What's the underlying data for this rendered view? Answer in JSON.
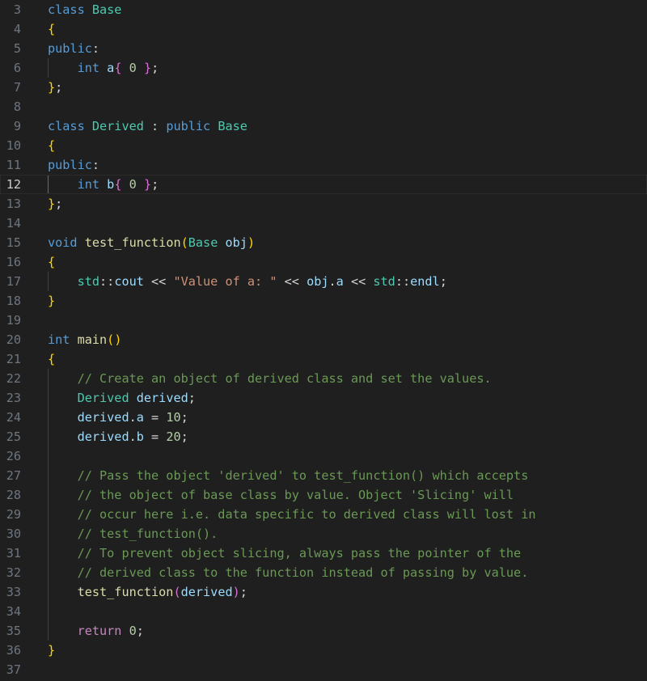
{
  "editor": {
    "theme_colors": {
      "background": "#1f1f1f",
      "keyword": "#569cd6",
      "control_keyword": "#c586c0",
      "type": "#4ec9b0",
      "variable": "#9cdcfe",
      "function": "#dcdcaa",
      "number": "#b5cea8",
      "string": "#ce9178",
      "comment": "#6a9955",
      "bracket_level_1": "#ffd700",
      "bracket_level_2": "#da70d6",
      "bracket_level_3": "#179fff",
      "line_number": "#6e7681"
    },
    "active_line_number": 12,
    "lines": [
      {
        "n": 3,
        "tokens": [
          [
            "kw",
            "class"
          ],
          [
            "op",
            " "
          ],
          [
            "type",
            "Base"
          ]
        ]
      },
      {
        "n": 4,
        "tokens": [
          [
            "br1",
            "{"
          ]
        ]
      },
      {
        "n": 5,
        "tokens": [
          [
            "kw",
            "public"
          ],
          [
            "op",
            ":"
          ]
        ]
      },
      {
        "n": 6,
        "tokens": [
          [
            "op",
            "    "
          ],
          [
            "kw",
            "int"
          ],
          [
            "op",
            " "
          ],
          [
            "var",
            "a"
          ],
          [
            "br2",
            "{"
          ],
          [
            "op",
            " "
          ],
          [
            "num",
            "0"
          ],
          [
            "op",
            " "
          ],
          [
            "br2",
            "}"
          ],
          [
            "op",
            ";"
          ]
        ]
      },
      {
        "n": 7,
        "tokens": [
          [
            "br1",
            "}"
          ],
          [
            "op",
            ";"
          ]
        ]
      },
      {
        "n": 8,
        "tokens": []
      },
      {
        "n": 9,
        "tokens": [
          [
            "kw",
            "class"
          ],
          [
            "op",
            " "
          ],
          [
            "type",
            "Derived"
          ],
          [
            "op",
            " : "
          ],
          [
            "kw",
            "public"
          ],
          [
            "op",
            " "
          ],
          [
            "type",
            "Base"
          ]
        ]
      },
      {
        "n": 10,
        "tokens": [
          [
            "br1",
            "{"
          ]
        ]
      },
      {
        "n": 11,
        "tokens": [
          [
            "kw",
            "public"
          ],
          [
            "op",
            ":"
          ]
        ]
      },
      {
        "n": 12,
        "tokens": [
          [
            "op",
            "    "
          ],
          [
            "kw",
            "int"
          ],
          [
            "op",
            " "
          ],
          [
            "var",
            "b"
          ],
          [
            "br2",
            "{"
          ],
          [
            "op",
            " "
          ],
          [
            "num",
            "0"
          ],
          [
            "op",
            " "
          ],
          [
            "br2",
            "}"
          ],
          [
            "op",
            ";"
          ]
        ]
      },
      {
        "n": 13,
        "tokens": [
          [
            "br1",
            "}"
          ],
          [
            "op",
            ";"
          ]
        ]
      },
      {
        "n": 14,
        "tokens": []
      },
      {
        "n": 15,
        "tokens": [
          [
            "kw",
            "void"
          ],
          [
            "op",
            " "
          ],
          [
            "fn",
            "test_function"
          ],
          [
            "br1",
            "("
          ],
          [
            "type",
            "Base"
          ],
          [
            "op",
            " "
          ],
          [
            "var",
            "obj"
          ],
          [
            "br1",
            ")"
          ]
        ]
      },
      {
        "n": 16,
        "tokens": [
          [
            "br1",
            "{"
          ]
        ]
      },
      {
        "n": 17,
        "tokens": [
          [
            "op",
            "    "
          ],
          [
            "type",
            "std"
          ],
          [
            "op",
            "::"
          ],
          [
            "var",
            "cout"
          ],
          [
            "op",
            " << "
          ],
          [
            "str",
            "\"Value of a: \""
          ],
          [
            "op",
            " << "
          ],
          [
            "var",
            "obj"
          ],
          [
            "op",
            "."
          ],
          [
            "var",
            "a"
          ],
          [
            "op",
            " << "
          ],
          [
            "type",
            "std"
          ],
          [
            "op",
            "::"
          ],
          [
            "var",
            "endl"
          ],
          [
            "op",
            ";"
          ]
        ]
      },
      {
        "n": 18,
        "tokens": [
          [
            "br1",
            "}"
          ]
        ]
      },
      {
        "n": 19,
        "tokens": []
      },
      {
        "n": 20,
        "tokens": [
          [
            "kw",
            "int"
          ],
          [
            "op",
            " "
          ],
          [
            "fn",
            "main"
          ],
          [
            "br1",
            "()"
          ]
        ]
      },
      {
        "n": 21,
        "tokens": [
          [
            "br1",
            "{"
          ]
        ]
      },
      {
        "n": 22,
        "tokens": [
          [
            "op",
            "    "
          ],
          [
            "cmt",
            "// Create an object of derived class and set the values."
          ]
        ]
      },
      {
        "n": 23,
        "tokens": [
          [
            "op",
            "    "
          ],
          [
            "type",
            "Derived"
          ],
          [
            "op",
            " "
          ],
          [
            "var",
            "derived"
          ],
          [
            "op",
            ";"
          ]
        ]
      },
      {
        "n": 24,
        "tokens": [
          [
            "op",
            "    "
          ],
          [
            "var",
            "derived"
          ],
          [
            "op",
            "."
          ],
          [
            "var",
            "a"
          ],
          [
            "op",
            " = "
          ],
          [
            "num",
            "10"
          ],
          [
            "op",
            ";"
          ]
        ]
      },
      {
        "n": 25,
        "tokens": [
          [
            "op",
            "    "
          ],
          [
            "var",
            "derived"
          ],
          [
            "op",
            "."
          ],
          [
            "var",
            "b"
          ],
          [
            "op",
            " = "
          ],
          [
            "num",
            "20"
          ],
          [
            "op",
            ";"
          ]
        ]
      },
      {
        "n": 26,
        "tokens": []
      },
      {
        "n": 27,
        "tokens": [
          [
            "op",
            "    "
          ],
          [
            "cmt",
            "// Pass the object 'derived' to test_function() which accepts"
          ]
        ]
      },
      {
        "n": 28,
        "tokens": [
          [
            "op",
            "    "
          ],
          [
            "cmt",
            "// the object of base class by value. Object 'Slicing' will"
          ]
        ]
      },
      {
        "n": 29,
        "tokens": [
          [
            "op",
            "    "
          ],
          [
            "cmt",
            "// occur here i.e. data specific to derived class will lost in"
          ]
        ]
      },
      {
        "n": 30,
        "tokens": [
          [
            "op",
            "    "
          ],
          [
            "cmt",
            "// test_function()."
          ]
        ]
      },
      {
        "n": 31,
        "tokens": [
          [
            "op",
            "    "
          ],
          [
            "cmt",
            "// To prevent object slicing, always pass the pointer of the"
          ]
        ]
      },
      {
        "n": 32,
        "tokens": [
          [
            "op",
            "    "
          ],
          [
            "cmt",
            "// derived class to the function instead of passing by value."
          ]
        ]
      },
      {
        "n": 33,
        "tokens": [
          [
            "op",
            "    "
          ],
          [
            "fn",
            "test_function"
          ],
          [
            "br2",
            "("
          ],
          [
            "var",
            "derived"
          ],
          [
            "br2",
            ")"
          ],
          [
            "op",
            ";"
          ]
        ]
      },
      {
        "n": 34,
        "tokens": []
      },
      {
        "n": 35,
        "tokens": [
          [
            "op",
            "    "
          ],
          [
            "ctl",
            "return"
          ],
          [
            "op",
            " "
          ],
          [
            "num",
            "0"
          ],
          [
            "op",
            ";"
          ]
        ]
      },
      {
        "n": 36,
        "tokens": [
          [
            "br1",
            "}"
          ]
        ]
      },
      {
        "n": 37,
        "tokens": []
      }
    ]
  }
}
